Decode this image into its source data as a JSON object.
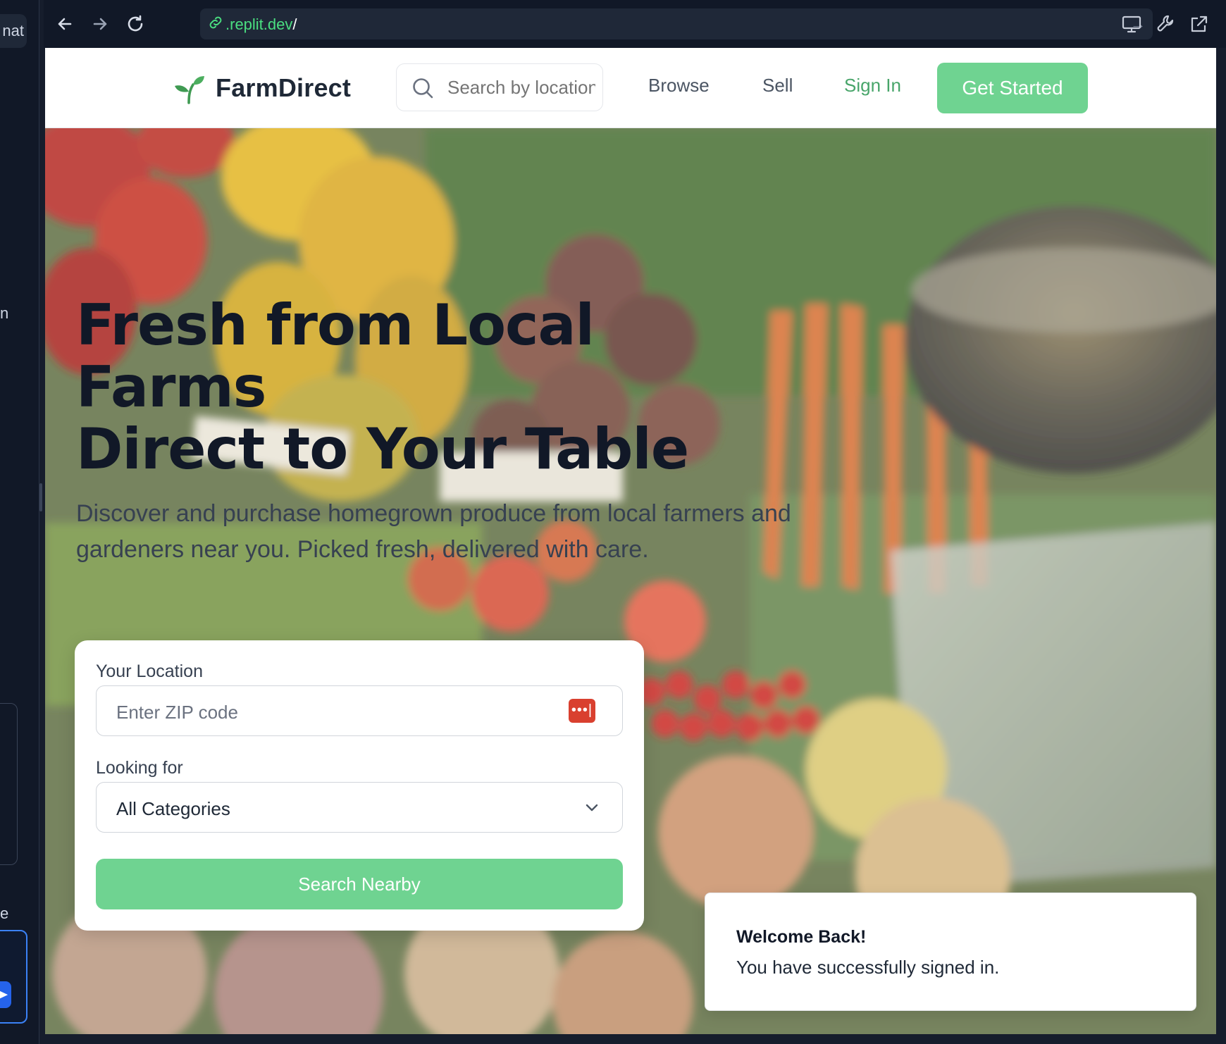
{
  "left_panel": {
    "chip_fragment": "nat",
    "text_fragment_n": "n",
    "text_fragment_e": "e"
  },
  "browser": {
    "url_domain": ".replit.dev",
    "url_path": "/",
    "icons": [
      "back-icon",
      "forward-icon",
      "reload-icon",
      "link-icon",
      "go-arrow-icon",
      "display-icon",
      "wrench-icon",
      "open-external-icon"
    ]
  },
  "header": {
    "brand": "FarmDirect",
    "search_placeholder": "Search by location",
    "nav": {
      "browse": "Browse",
      "sell": "Sell",
      "sign_in": "Sign In"
    },
    "cta": "Get Started"
  },
  "hero": {
    "title_line1": "Fresh from Local",
    "title_line2": "Farms",
    "title_line3": "Direct to Your Table",
    "subtitle": "Discover and purchase homegrown produce from local farmers and gardeners near you. Picked fresh, delivered with care."
  },
  "search_card": {
    "location_label": "Your Location",
    "zip_placeholder": "Enter ZIP code",
    "category_label": "Looking for",
    "category_selected": "All Categories",
    "submit": "Search Nearby"
  },
  "toast": {
    "title": "Welcome Back!",
    "description": "You have successfully signed in."
  },
  "colors": {
    "brand_green": "#6fd391",
    "link_green": "#48a56a",
    "heading": "#111827",
    "chrome_bg": "#111827",
    "password_manager_red": "#d9402f"
  }
}
